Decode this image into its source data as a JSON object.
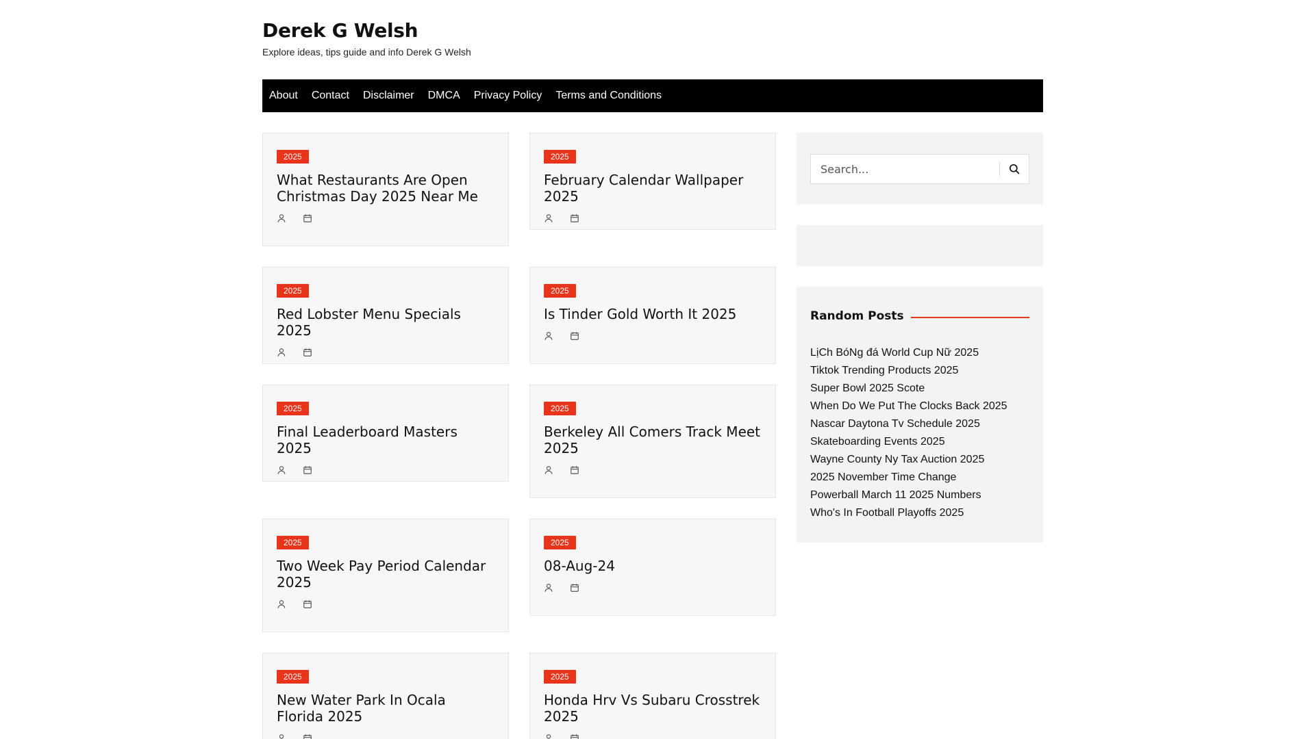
{
  "site": {
    "title": "Derek G Welsh",
    "description": "Explore ideas, tips guide and info Derek G Welsh"
  },
  "nav": [
    "About",
    "Contact",
    "Disclaimer",
    "DMCA",
    "Privacy Policy",
    "Terms and Conditions"
  ],
  "posts": [
    {
      "category": "2025",
      "title": "What Restaurants Are Open Christmas Day 2025 Near Me"
    },
    {
      "category": "2025",
      "title": "February Calendar Wallpaper 2025"
    },
    {
      "category": "2025",
      "title": "Red Lobster Menu Specials 2025"
    },
    {
      "category": "2025",
      "title": "Is Tinder Gold Worth It 2025"
    },
    {
      "category": "2025",
      "title": "Final Leaderboard Masters 2025"
    },
    {
      "category": "2025",
      "title": "Berkeley All Comers Track Meet 2025"
    },
    {
      "category": "2025",
      "title": "Two Week Pay Period Calendar 2025"
    },
    {
      "category": "2025",
      "title": "08-Aug-24"
    },
    {
      "category": "2025",
      "title": "New Water Park In Ocala Florida 2025"
    },
    {
      "category": "2025",
      "title": "Honda Hrv Vs Subaru Crosstrek 2025"
    }
  ],
  "icons": {
    "author": "user-icon",
    "date": "calendar-icon",
    "search": "search-icon"
  },
  "colors": {
    "accent": "#e8341b",
    "nav_bg": "#000000",
    "card_bg": "#f7f7f7",
    "widget_bg": "#f3f3f3"
  },
  "sidebar": {
    "search_placeholder": "Search...",
    "random_posts_title": "Random Posts",
    "random_posts": [
      "LịCh BóNg đá World Cup Nữ 2025",
      "Tiktok Trending Products 2025",
      "Super Bowl 2025 Scote",
      "When Do We Put The Clocks Back 2025",
      "Nascar Daytona Tv Schedule 2025",
      "Skateboarding Events 2025",
      "Wayne County Ny Tax Auction 2025",
      "2025 November Time Change",
      "Powerball March 11 2025 Numbers",
      "Who's In Football Playoffs 2025"
    ]
  }
}
